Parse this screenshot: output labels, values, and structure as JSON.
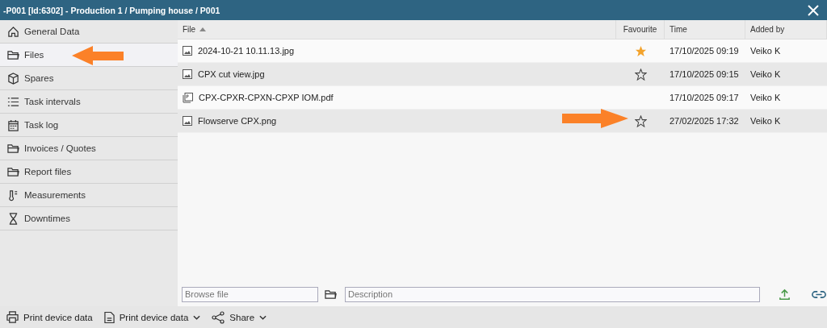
{
  "window": {
    "title": "-P001 [Id:6302] - Production 1 / Pumping house / P001"
  },
  "sidebar": {
    "items": [
      {
        "label": "General Data",
        "kind": "home",
        "selected": false
      },
      {
        "label": "Files",
        "kind": "folder",
        "selected": true
      },
      {
        "label": "Spares",
        "kind": "box",
        "selected": false
      },
      {
        "label": "Task intervals",
        "kind": "list",
        "selected": false
      },
      {
        "label": "Task log",
        "kind": "calendar",
        "selected": false
      },
      {
        "label": "Invoices / Quotes",
        "kind": "folder",
        "selected": false
      },
      {
        "label": "Report files",
        "kind": "folder",
        "selected": false
      },
      {
        "label": "Measurements",
        "kind": "thermometer",
        "selected": false
      },
      {
        "label": "Downtimes",
        "kind": "hourglass",
        "selected": false
      }
    ]
  },
  "table": {
    "columns": [
      {
        "label": "File",
        "sorted": true
      },
      {
        "label": "Favourite",
        "sorted": false
      },
      {
        "label": "Time",
        "sorted": false
      },
      {
        "label": "Added by",
        "sorted": false
      }
    ],
    "rows": [
      {
        "kind": "image",
        "file": "2024-10-21 10.11.13.jpg",
        "favourite": true,
        "time": "17/10/2025 09:19",
        "added_by": "Veiko K"
      },
      {
        "kind": "image",
        "file": "CPX cut view.jpg",
        "favourite": false,
        "time": "17/10/2025 09:15",
        "added_by": "Veiko K"
      },
      {
        "kind": "pdf",
        "file": "CPX-CPXR-CPXN-CPXP IOM.pdf",
        "favourite": null,
        "time": "17/10/2025 09:17",
        "added_by": "Veiko K"
      },
      {
        "kind": "image",
        "file": "Flowserve CPX.png",
        "favourite": false,
        "time": "27/02/2025 17:32",
        "added_by": "Veiko K"
      }
    ]
  },
  "upload": {
    "browse_placeholder": "Browse file",
    "description_placeholder": "Description"
  },
  "footer": [
    {
      "label": "Print device data",
      "kind": "printer",
      "dropdown": false
    },
    {
      "label": "Print device data",
      "kind": "document",
      "dropdown": true
    },
    {
      "label": "Share",
      "kind": "share",
      "dropdown": true
    }
  ]
}
